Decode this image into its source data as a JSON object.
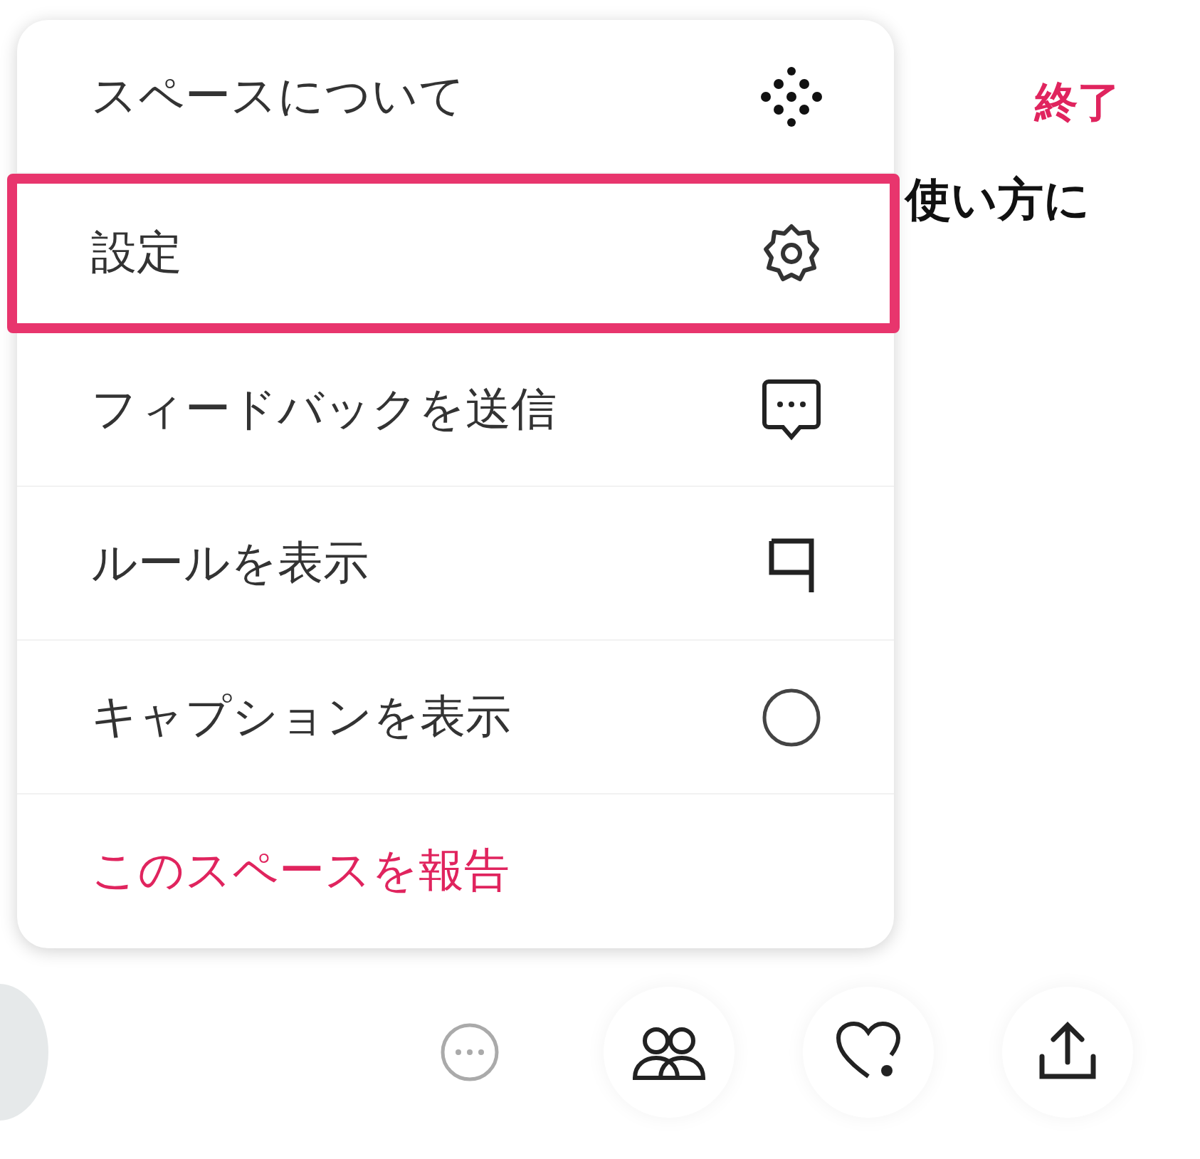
{
  "header": {
    "end_button": "終了",
    "title": "使い方に"
  },
  "menu": {
    "items": [
      {
        "label": "スペースについて",
        "kind": "action",
        "selected": false
      },
      {
        "label": "設定",
        "kind": "action",
        "selected": true
      },
      {
        "label": "フィードバックを送信",
        "kind": "action",
        "selected": false
      },
      {
        "label": "ルールを表示",
        "kind": "action",
        "selected": false
      },
      {
        "label": "キャプションを表示",
        "kind": "action",
        "selected": false
      },
      {
        "label": "このスペースを報告",
        "kind": "danger",
        "selected": false
      }
    ]
  }
}
